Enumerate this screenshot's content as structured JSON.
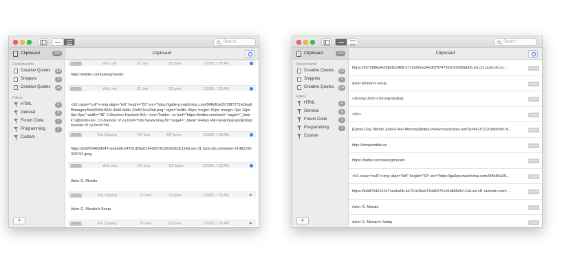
{
  "search": {
    "placeholder": "Search"
  },
  "sidebar": {
    "header": {
      "label": "Clipboard",
      "count": "150"
    },
    "pasteboards_title": "Pasteboards",
    "pasteboards": [
      {
        "label": "Creative Quotes",
        "count": "14"
      },
      {
        "label": "Snippets",
        "count": "5"
      },
      {
        "label": "Creative Quotes",
        "count": "14"
      }
    ],
    "filters_title": "Filters",
    "filters": [
      {
        "label": "HTML",
        "count": "6"
      },
      {
        "label": "General",
        "count": "8"
      },
      {
        "label": "Forum Code",
        "count": "1"
      },
      {
        "label": "Programming",
        "count": "1"
      },
      {
        "label": "Custom",
        "count": ""
      }
    ],
    "add_label": "+"
  },
  "main": {
    "title": "Clipboard"
  },
  "left_entries": [
    {
      "text": "Web Link",
      "meta": {
        "tag": "HTTP",
        "kind": "Web Link",
        "chars": "32 char",
        "bytes": "32 bytes",
        "date": "12/8/16, 7:25 AM"
      }
    },
    {
      "text": "https://twitter.com/asiergmorato",
      "meta": {
        "tag": "HTTP",
        "kind": "Web Link",
        "chars": "32 char",
        "bytes": "32 bytes",
        "date": "12/8/16, 7:25 AM"
      }
    },
    {
      "text": "<h3 class=\"null\"><img align=\"left\" height=\"50\" src=\"https://gallery.mailchimp.com/9f4b80a35728f7271fe3ea6ff/images/5da9590f-f699-45d8-8a8c-33d503ca7fab.png\" style=\"width: 46px; height: 50px; margin: 0px 10px 0px 0px;\" width=\"46\" />Stephen Hackett</h3> <em>Twitter: <a href=\"https://twitter.com/ismh\" target=\"_blank\">@ismh</a>. Co-founder of <a href=\"http://www.relay.fm\" target=\"_blank\">Relay FM</a>&nbsp;and&nbsp;founder of <a href=\"htt...",
      "meta": {
        "tag": "TEXT",
        "kind": "Text Clipping",
        "chars": "497 char",
        "bytes": "497 bytes",
        "date": "12/8/16, 7:39 AM"
      }
    },
    {
      "text": "https://bddf794624247cea6a0b-b4761d2ba0154d0276c36dbf2b3c114d.ssl.cf1.rackcdn.com/asier-21481290320763.jpeg",
      "meta": {
        "tag": "HTTP",
        "kind": "Web Link",
        "chars": "107 char",
        "bytes": "107 bytes",
        "date": "12/8/16, 7:25 AM"
      }
    },
    {
      "text": "Asier G. Morato",
      "meta": {
        "tag": "TEXT",
        "kind": "Text Clipping",
        "chars": "15 char",
        "bytes": "15 bytes",
        "date": "12/8/16, 7:25 AM"
      }
    },
    {
      "text": "Asier G. Morato's Setup",
      "meta": {
        "tag": "TEXT",
        "kind": "Text Clipping",
        "chars": "23 char",
        "bytes": "23 bytes",
        "date": "12/8/16, 7:25 AM"
      }
    }
  ],
  "right_rows": [
    {
      "text": "https://2672686a4cf38e8c2458-2712e00ea34e3076747650c92426bbb5.ssl.cf1.rackcdn.co...",
      "tag": "HTTP"
    },
    {
      "text": "Asier Morato's setup,",
      "tag": "TEXT"
    },
    {
      "text": "<strong>John:</strong>&nbsp;",
      "tag": "TEXT"
    },
    {
      "text": "</br>",
      "tag": "TEXT"
    },
    {
      "text": "[Game Day: Apollo Justice Ace Attorney](https://www.macstories.net/?p=46157) (Twitterrific A...",
      "tag": "TEXT"
    },
    {
      "text": "http://elimperdible.es",
      "tag": "HTTP"
    },
    {
      "text": "https://twitter.com/asiergmorato",
      "tag": "HTTP"
    },
    {
      "text": "<h3 class=\"null\"><img align=\"left\" height=\"50\" src=\"https://gallery.mailchimp.com/9f4b80a35...",
      "tag": "TEXT"
    },
    {
      "text": "https://bddf794624247cea6a0b-b4761d2ba0154d0276c36dbf2b3c114d.ssl.cf1.rackcdn.com/...",
      "tag": "HTTP"
    },
    {
      "text": "Asier G. Morato",
      "tag": "TEXT"
    },
    {
      "text": "Asier G. Morato's Setup",
      "tag": "TEXT"
    }
  ]
}
